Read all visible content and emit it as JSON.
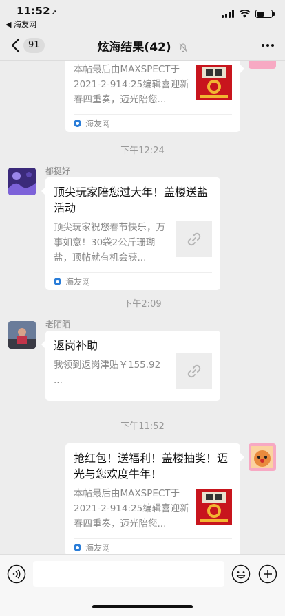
{
  "status_bar": {
    "time": "11:52",
    "location_arrow": "location-arrow-icon",
    "back_app": "◀ 海友网"
  },
  "nav": {
    "unread_count": "91",
    "title": "炫海结果(42)",
    "icons": [
      "back-chevron-icon",
      "mute-bell-icon",
      "more-dots-icon"
    ]
  },
  "messages": [
    {
      "type": "card",
      "side": "right",
      "title": "",
      "description": "本帖最后由MAXSPECT于2021-2-914:25编辑喜迎新春四重奏，迈光陪您...",
      "source": "海友网",
      "thumb": "red-envelope-image"
    },
    {
      "type": "timestamp",
      "text": "下午12:24"
    },
    {
      "type": "card",
      "side": "left",
      "sender": "都挺好",
      "title": "顶尖玩家陪您过大年！盖楼送盐活动",
      "description": "顶尖玩家祝您春节快乐，万事如意！30袋2公斤珊瑚盐，顶帖就有机会获...",
      "source": "海友网",
      "thumb": "link-icon"
    },
    {
      "type": "timestamp",
      "text": "下午2:09"
    },
    {
      "type": "card",
      "side": "left",
      "sender": "老陌陌",
      "title": "返岗补助",
      "description": "我领到返岗津贴￥155.92 ...",
      "source": "",
      "thumb": "link-icon"
    },
    {
      "type": "timestamp",
      "text": "下午11:52"
    },
    {
      "type": "card",
      "side": "right",
      "title": "抢红包！送福利！盖楼抽奖！迈光与您欢度牛年！",
      "description": "本帖最后由MAXSPECT于2021-2-914:25编辑喜迎新春四重奏，迈光陪您...",
      "source": "海友网",
      "thumb": "red-envelope-image"
    }
  ],
  "input_bar": {
    "placeholder": "",
    "icons": [
      "voice-icon",
      "emoji-icon",
      "plus-icon"
    ]
  },
  "colors": {
    "background": "#ededed",
    "card": "#ffffff",
    "muted_text": "#888888",
    "source_icon": "#2a7dd8"
  }
}
